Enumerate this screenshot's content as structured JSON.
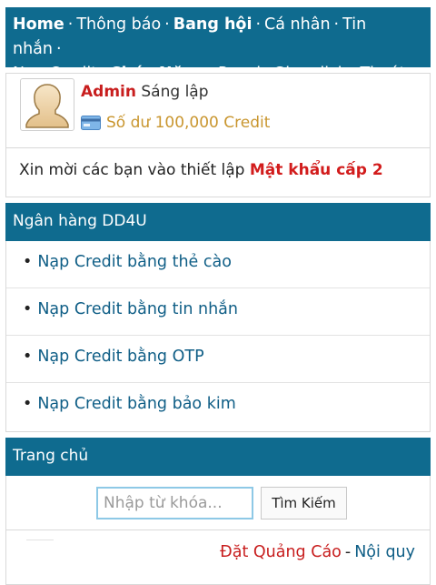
{
  "nav": {
    "items": [
      {
        "label": "Home",
        "bold": true
      },
      {
        "label": "Thông báo",
        "bold": false
      },
      {
        "label": "Bang hội",
        "bold": true
      },
      {
        "label": "Cá nhân",
        "bold": false
      },
      {
        "label": "Tin nhắn",
        "bold": false
      },
      {
        "label": "Nạp Credit",
        "bold": false
      },
      {
        "label": "Chức Năng",
        "bold": true
      },
      {
        "label": "Panel",
        "bold": false
      },
      {
        "label": "Giao dịch",
        "bold": false
      },
      {
        "label": "Thoát",
        "bold": false
      }
    ],
    "separator": "·"
  },
  "user": {
    "name": "Admin",
    "role": "Sáng lập",
    "balance": "Số dư 100,000 Credit",
    "avatar_icon": "user-avatar-icon",
    "card_icon": "credit-card-icon"
  },
  "notice": {
    "text": "Xin mời các bạn vào thiết lập ",
    "link": "Mật khẩu cấp 2"
  },
  "bank": {
    "title": "Ngân hàng DD4U",
    "items": [
      {
        "label": "Nạp Credit bằng thẻ cào"
      },
      {
        "label": "Nạp Credit bằng tin nhắn"
      },
      {
        "label": "Nạp Credit bằng OTP"
      },
      {
        "label": "Nạp Credit bằng bảo kim"
      }
    ]
  },
  "home": {
    "title": "Trang chủ"
  },
  "search": {
    "placeholder": "Nhập từ khóa...",
    "value": "",
    "button": "Tìm Kiếm"
  },
  "footer": {
    "ads": "Đặt Quảng Cáo",
    "dash": "-",
    "rules": "Nội quy"
  },
  "colors": {
    "header_bg": "#0f6b8f",
    "accent_red": "#c81e1e",
    "link_blue": "#0f5e86",
    "balance_gold": "#c9962f"
  }
}
